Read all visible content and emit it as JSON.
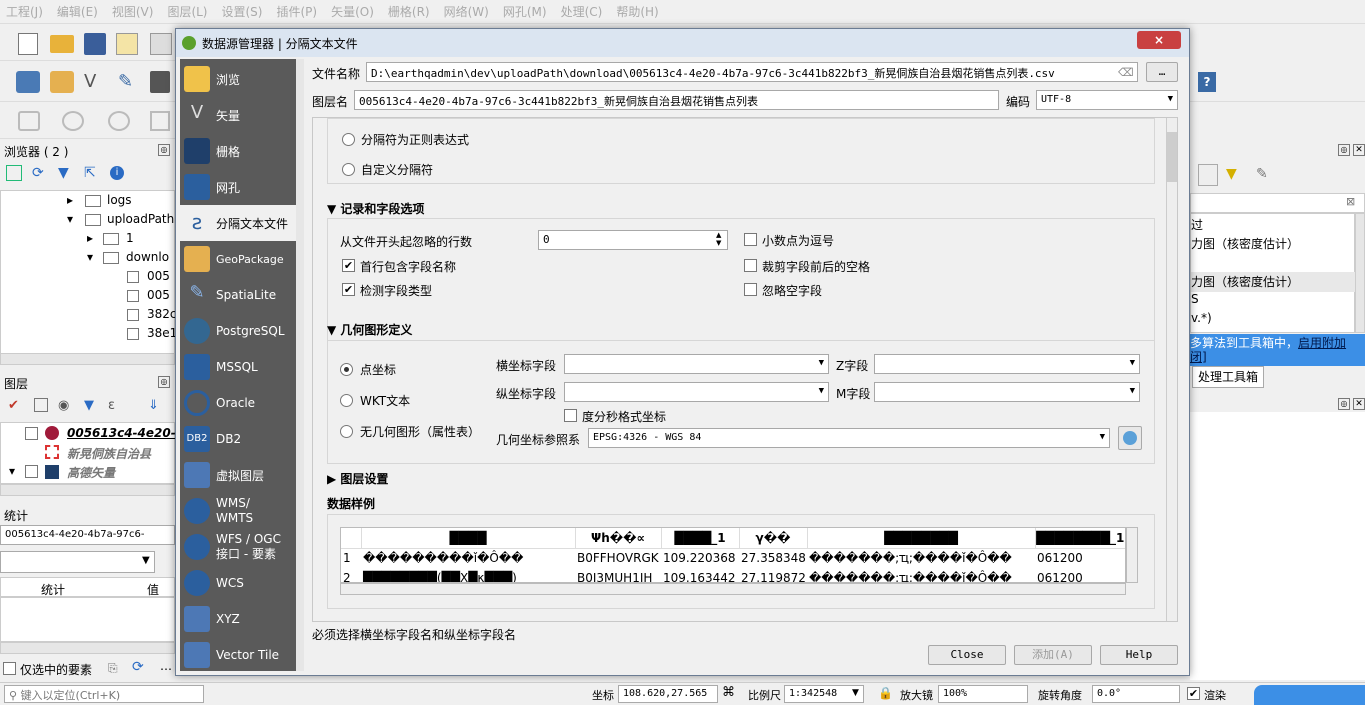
{
  "menu": [
    "工程(J)",
    "编辑(E)",
    "视图(V)",
    "图层(L)",
    "设置(S)",
    "插件(P)",
    "矢量(O)",
    "栅格(R)",
    "网络(W)",
    "网孔(M)",
    "处理(C)",
    "帮助(H)"
  ],
  "browser": {
    "title": "浏览器 ( 2 )",
    "items": [
      "logs",
      "uploadPath",
      "1",
      "downlo",
      "005",
      "005",
      "382c",
      "38e1"
    ]
  },
  "layers": {
    "title": "图层",
    "items": [
      "005613c4-4e20-",
      "新晃侗族自治县",
      "高德矢量"
    ]
  },
  "stats": {
    "title": "统计",
    "layer": "005613c4-4e20-4b7a-97c6-",
    "col1": "统计",
    "col2": "值",
    "only_selected": "仅选中的要素"
  },
  "right": {
    "items": [
      "过",
      "力图（核密度估计）",
      "力图（核密度估计）",
      "S",
      "v.*)"
    ],
    "tip_text": "多算法到工具箱中，",
    "tip_link": "启用附加",
    "tip_link2": "闭]",
    "toolbox_tab": "处理工具箱"
  },
  "dialog": {
    "title": "数据源管理器 | 分隔文本文件",
    "close": "×",
    "sidebar": [
      "浏览",
      "矢量",
      "栅格",
      "网孔",
      "分隔文本文件",
      "GeoPackage",
      "SpatiaLite",
      "PostgreSQL",
      "MSSQL",
      "Oracle",
      "DB2",
      "虚拟图层",
      "WMS/\nWMTS",
      "WFS / OGC\n接口 - 要素",
      "WCS",
      "XYZ",
      "Vector Tile"
    ],
    "file_label": "文件名称",
    "file_value": "D:\\earthqadmin\\dev\\uploadPath\\download\\005613c4-4e20-4b7a-97c6-3c441b822bf3_新晃侗族自治县烟花销售点列表.csv",
    "browse_btn": "…",
    "layer_label": "图层名",
    "layer_value": "005613c4-4e20-4b7a-97c6-3c441b822bf3_新晃侗族自治县烟花销售点列表",
    "enc_label": "编码",
    "enc_value": "UTF-8",
    "regex_opt": "分隔符为正则表达式",
    "custom_opt": "自定义分隔符",
    "rec_section": "记录和字段选项",
    "skip_label": "从文件开头起忽略的行数",
    "skip_value": "0",
    "header_chk": "首行包含字段名称",
    "detect_chk": "检测字段类型",
    "decimal_chk": "小数点为逗号",
    "trim_chk": "裁剪字段前后的空格",
    "discard_chk": "忽略空字段",
    "geom_section": "几何图形定义",
    "point_opt": "点坐标",
    "wkt_opt": "WKT文本",
    "nogeom_opt": "无几何图形（属性表）",
    "x_label": "横坐标字段",
    "y_label": "纵坐标字段",
    "z_label": "Z字段",
    "m_label": "M字段",
    "dms_chk": "度分秒格式坐标",
    "crs_label": "几何坐标参照系",
    "crs_value": "EPSG:4326 - WGS 84",
    "layer_settings": "图层设置",
    "sample_title": "数据样例",
    "table_headers": [
      "",
      "████",
      "Ψh��∝",
      "████_1",
      "γ��",
      "████████",
      "████████_1"
    ],
    "table_rows": [
      [
        "1",
        "���������ǐ�Ô��",
        "B0FFHOVRGK",
        "109.220368",
        "27.358348",
        "�������;ҵ;����ǐ�Ô��",
        "061200"
      ],
      [
        "2",
        "████████(██X█κ███)",
        "B0J3MUH1IH",
        "109.163442",
        "27.119872",
        "�������;ҵ;����ǐ�Ô��",
        "061200"
      ]
    ],
    "warning": "必须选择横坐标字段名和纵坐标字段名",
    "btn_close": "Close",
    "btn_add": "添加(A)",
    "btn_help": "Help"
  },
  "statusbar": {
    "locate": "键入以定位(Ctrl+K)",
    "coord_label": "坐标",
    "coord_value": "108.620,27.565",
    "scale_label": "比例尺",
    "scale_value": "1:342548",
    "mag_label": "放大镜",
    "mag_value": "100%",
    "rot_label": "旋转角度",
    "rot_value": "0.0°",
    "render_label": "渲染"
  }
}
